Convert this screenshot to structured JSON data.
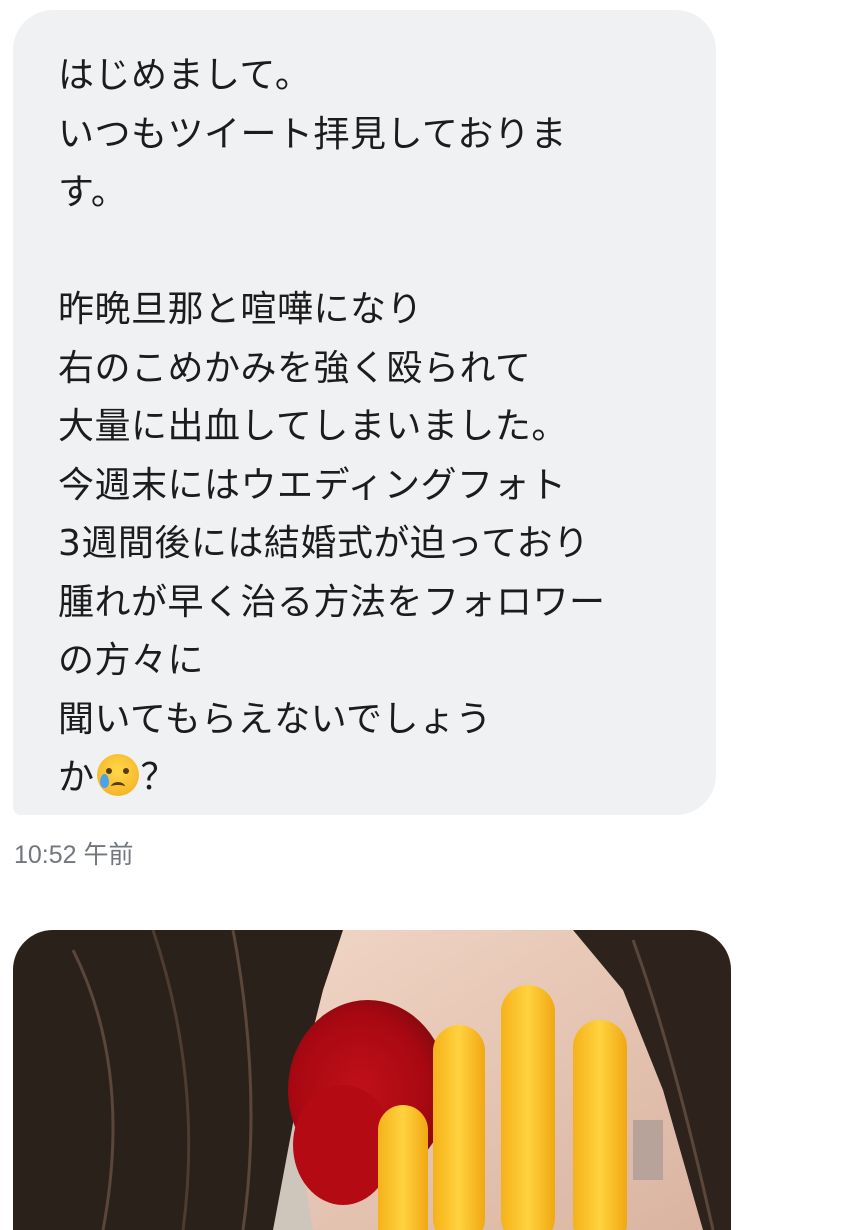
{
  "message": {
    "lines": [
      "はじめまして。",
      "いつもツイート拝見しておりま",
      "す。",
      "",
      "昨晩旦那と喧嘩になり",
      "右のこめかみを強く殴られて",
      "大量に出血してしまいました。",
      "今週末にはウエディングフォト",
      "3週間後には結婚式が迫っており",
      "腫れが早く治る方法をフォロワー",
      "の方々に",
      "聞いてもらえないでしょう"
    ],
    "last_line_prefix": "か",
    "last_line_emoji": "crying-face-icon",
    "last_line_suffix": "？",
    "timestamp": "10:52 午前"
  },
  "attachment": {
    "type": "image",
    "description_icon": "photo-attachment"
  },
  "colors": {
    "bubble_background": "#eff1f3",
    "message_text": "#1c1c1c",
    "timestamp_text": "#71777d"
  }
}
